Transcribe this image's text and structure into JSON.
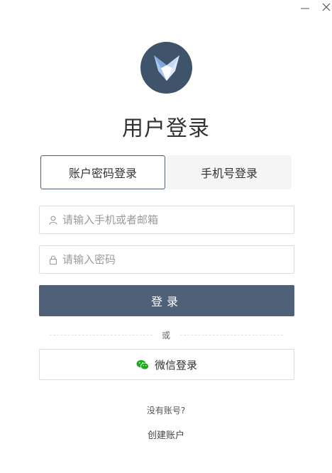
{
  "window": {
    "minimize_icon": "minimize-icon",
    "close_icon": "close-icon"
  },
  "header": {
    "logo_icon": "fox-logo-icon",
    "title": "用户登录"
  },
  "tabs": [
    {
      "label": "账户密码登录",
      "active": true
    },
    {
      "label": "手机号登录",
      "active": false
    }
  ],
  "form": {
    "username": {
      "value": "",
      "placeholder": "请输入手机或者邮箱",
      "icon": "user-icon"
    },
    "password": {
      "value": "",
      "placeholder": "请输入密码",
      "icon": "lock-icon"
    },
    "login_label": "登录"
  },
  "divider": {
    "text": "或"
  },
  "wechat": {
    "label": "微信登录",
    "icon": "wechat-icon",
    "icon_color": "#1aad19"
  },
  "footer": {
    "no_account_text": "没有账号?",
    "create_account_label": "创建账户"
  },
  "colors": {
    "primary": "#4e6178",
    "logo_bg": "#3f536a"
  }
}
